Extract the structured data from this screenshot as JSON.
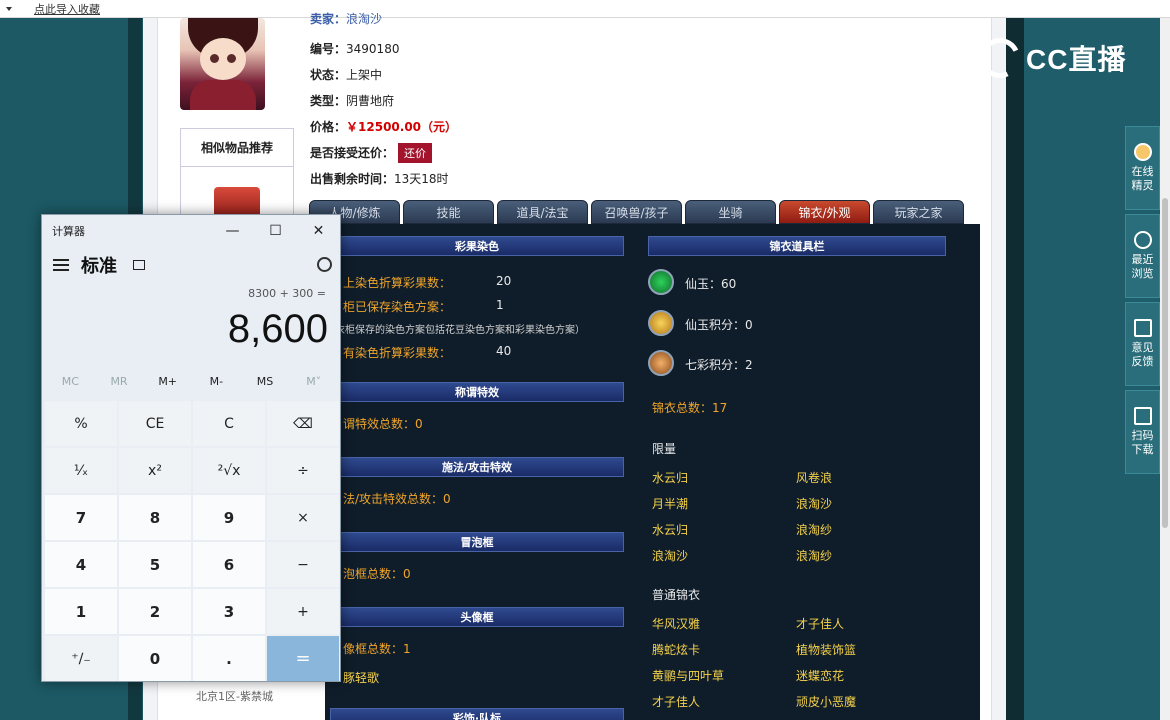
{
  "bookmark_bar": {
    "import_link": "点此导入收藏"
  },
  "item": {
    "seller_label": "卖家：",
    "seller_value": "浪淘沙",
    "id_label": "编号：",
    "id_value": "3490180",
    "status_label": "状态：",
    "status_value": "上架中",
    "type_label": "类型：",
    "type_value": "阴曹地府",
    "price_label": "价格：",
    "price_value": "￥12500.00（元）",
    "bargain_label": "是否接受还价：",
    "bargain_button": "还价",
    "remaining_label": "出售剩余时间：",
    "remaining_value": "13天18时"
  },
  "similar": {
    "title": "相似物品推荐"
  },
  "server_text": "北京1区-紫禁城",
  "tabs": [
    "人物/修炼",
    "技能",
    "道具/法宝",
    "召唤兽/孩子",
    "坐骑",
    "锦衣/外观",
    "玩家之家"
  ],
  "panel": {
    "left": {
      "h1": "彩果染色",
      "r1_label": "上染色折算彩果数：",
      "r1_value": "20",
      "r2_label": "柜已保存染色方案：",
      "r2_value": "1",
      "r2_note": "衣柜保存的染色方案包括花豆染色方案和彩果染色方案）",
      "r3_label": "有染色折算彩果数：",
      "r3_value": "40",
      "h2": "称谓特效",
      "t2": "谓特效总数：0",
      "h3": "施法/攻击特效",
      "t3": "法/攻击特效总数：0",
      "h4": "冒泡框",
      "t4": "泡框总数：0",
      "h5": "头像框",
      "t5": "像框总数：1",
      "t5b": "豚轻歌",
      "h6": "彩饰·队标"
    },
    "right": {
      "h1": "锦衣道具栏",
      "xianyu": "仙玉：60",
      "xianyu_points": "仙玉积分：0",
      "qicai_points": "七彩积分：2",
      "total": "锦衣总数：17",
      "limited_title": "限量",
      "limited": [
        [
          "水云归",
          "风卷浪"
        ],
        [
          "月半潮",
          "浪淘沙"
        ],
        [
          "水云归",
          "浪淘纱"
        ],
        [
          "浪淘沙",
          "浪淘纱"
        ]
      ],
      "normal_title": "普通锦衣",
      "normal": [
        [
          "华风汉雅",
          "才子佳人"
        ],
        [
          "腾蛇炫卡",
          "植物装饰篮"
        ],
        [
          "黄鹂与四叶草",
          "迷蝶恋花"
        ],
        [
          "才子佳人",
          "顽皮小恶魔"
        ]
      ]
    }
  },
  "cc_logo": "CC直播",
  "sidebar": [
    {
      "label1": "在线",
      "label2": "精灵"
    },
    {
      "label1": "最近",
      "label2": "浏览"
    },
    {
      "label1": "意见",
      "label2": "反馈"
    },
    {
      "label1": "扫码",
      "label2": "下载"
    }
  ],
  "calculator": {
    "title": "计算器",
    "mode": "标准",
    "expression": "8300 + 300 =",
    "result": "8,600",
    "memory": [
      "MC",
      "MR",
      "M+",
      "M-",
      "MS",
      "M˅"
    ],
    "keys": [
      "%",
      "CE",
      "C",
      "⌫",
      "¹⁄ₓ",
      "x²",
      "²√x",
      "÷",
      "7",
      "8",
      "9",
      "×",
      "4",
      "5",
      "6",
      "−",
      "1",
      "2",
      "3",
      "+",
      "⁺∕₋",
      "0",
      ".",
      "="
    ]
  }
}
